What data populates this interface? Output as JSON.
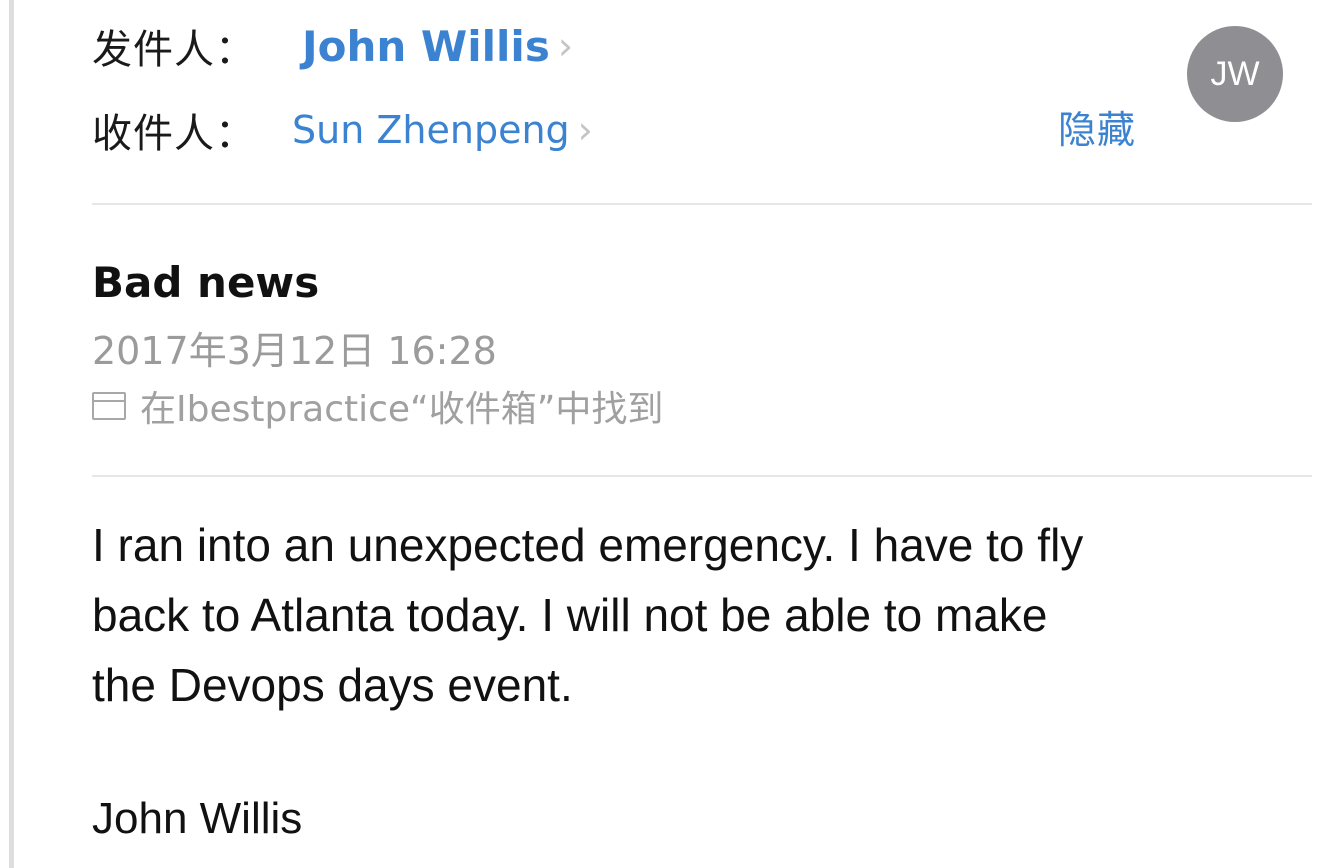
{
  "header": {
    "from_label": "发件人：",
    "from_name": "John Willis",
    "to_label": "收件人：",
    "to_name": "Sun Zhenpeng",
    "hide_label": "隐藏",
    "avatar_initials": "JW",
    "chevron": "›"
  },
  "message": {
    "subject": "Bad news",
    "datetime": "2017年3月12日 16:28",
    "location": "在Ibestpractice“收件箱”中找到",
    "body_lines": [
      "I ran into an unexpected emergency.  I have to fly",
      "back to Atlanta today.  I will not be able to make",
      "the Devops days event."
    ],
    "signature": "John Willis"
  },
  "icons": {
    "folder": "folder-icon",
    "chevron": "chevron-right-icon"
  },
  "colors": {
    "link_blue": "#3b82d1",
    "meta_gray": "#9b9b9b",
    "avatar_bg": "#8e8e93",
    "text": "#111111"
  }
}
